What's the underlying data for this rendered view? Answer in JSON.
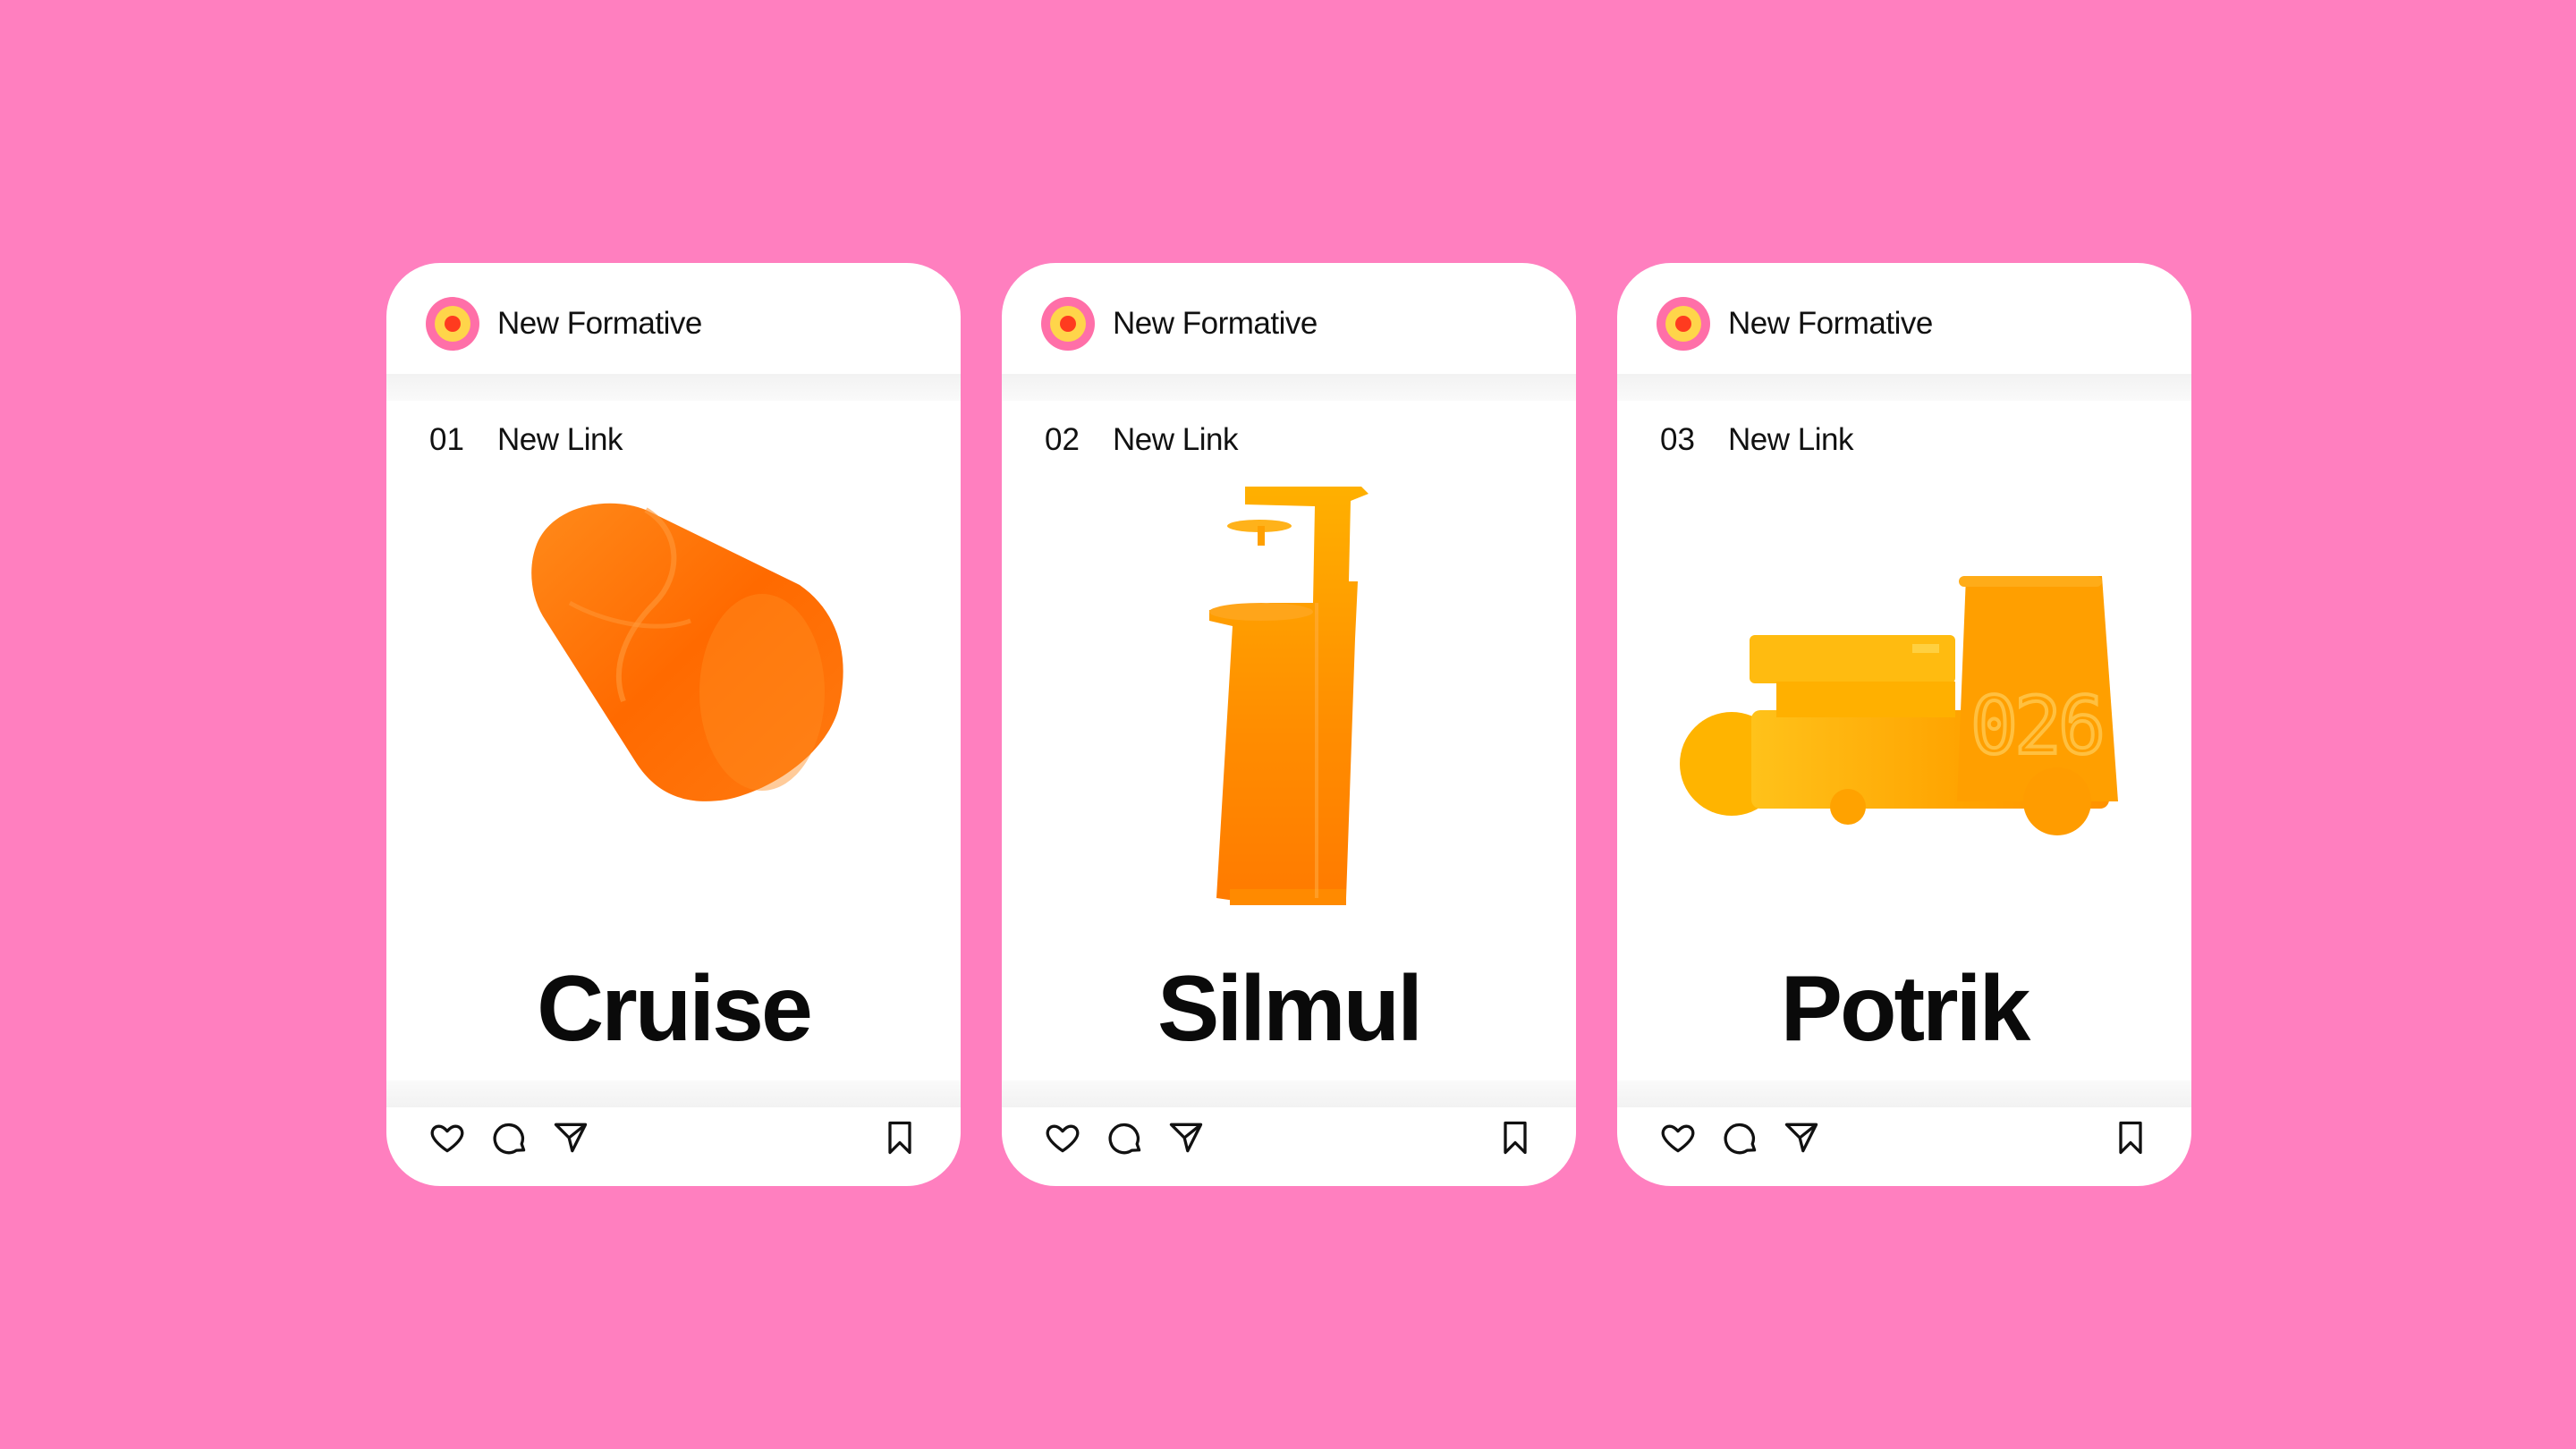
{
  "colors": {
    "background": "#ff7fbf",
    "card": "#ffffff",
    "avatar_outer": "#ff6fa8",
    "avatar_inner": "#ffd54a",
    "avatar_dot": "#ff3b1f"
  },
  "cards": [
    {
      "brand": "New Formative",
      "number": "01",
      "link": "New Link",
      "name": "Cruise",
      "icons": [
        "heart-icon",
        "comment-icon",
        "send-icon",
        "bookmark-icon"
      ]
    },
    {
      "brand": "New Formative",
      "number": "02",
      "link": "New Link",
      "name": "Silmul",
      "icons": [
        "heart-icon",
        "comment-icon",
        "send-icon",
        "bookmark-icon"
      ]
    },
    {
      "brand": "New Formative",
      "number": "03",
      "link": "New Link",
      "name": "Potrik",
      "icons": [
        "heart-icon",
        "comment-icon",
        "send-icon",
        "bookmark-icon"
      ]
    }
  ]
}
